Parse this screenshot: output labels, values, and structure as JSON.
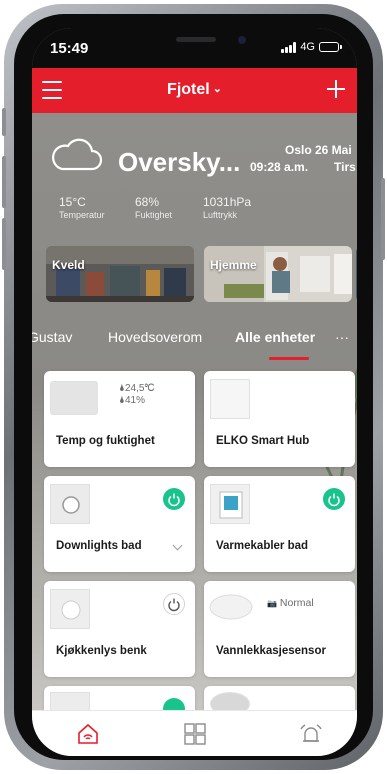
{
  "status_bar": {
    "time": "15:49",
    "network": "4G"
  },
  "app_bar": {
    "title": "Fjotel",
    "title_chevron": "⌄"
  },
  "weather": {
    "condition": "Oversky...",
    "city": "Oslo",
    "date": "26 Mai",
    "time": "09:28 a.m.",
    "day": "Tirs",
    "stats": [
      {
        "value": "15°C",
        "label": "Temperatur"
      },
      {
        "value": "68%",
        "label": "Fuktighet"
      },
      {
        "value": "1031hPa",
        "label": "Lufttrykk"
      }
    ]
  },
  "scenes": [
    {
      "label": "Kveld"
    },
    {
      "label": "Hjemme"
    }
  ],
  "room_tabs": [
    "Gustav",
    "Hovedsoverom",
    "Alle enheter",
    "···"
  ],
  "active_tab": "Alle enheter",
  "devices": [
    {
      "title": "Temp og fuktighet",
      "temperature": "🌢24,5℃",
      "humidity": "🌢41%"
    },
    {
      "title": "ELKO Smart Hub"
    },
    {
      "title": "Downlights bad",
      "power": "on"
    },
    {
      "title": "Varmekabler bad",
      "power": "on"
    },
    {
      "title": "Kjøkkenlys benk",
      "power": "off"
    },
    {
      "title": "Vannlekkasjesensor",
      "status": "Normal",
      "status_icon": "📷"
    }
  ],
  "bottom_nav": [
    "home-icon",
    "grid-icon",
    "alarm-icon"
  ],
  "colors": {
    "brand_red": "#e41e2b",
    "power_on": "#19c48c",
    "nav_active": "#e41e2b"
  }
}
